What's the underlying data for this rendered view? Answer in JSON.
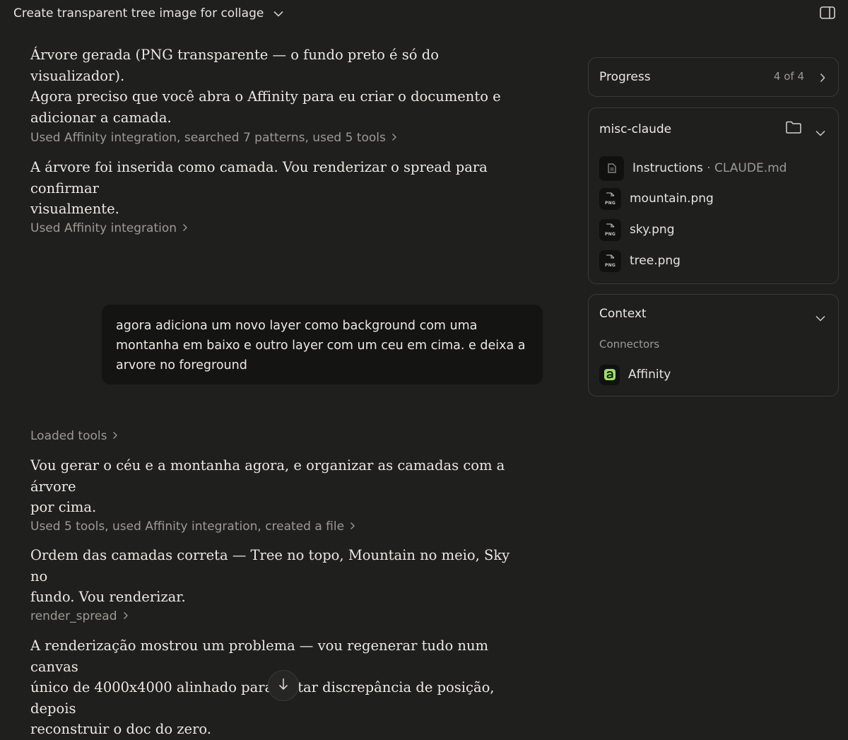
{
  "header": {
    "title": "Create transparent tree image for collage"
  },
  "chat": {
    "messages": [
      {
        "text_lines": [
          "Árvore gerada (PNG transparente — o fundo preto é só do visualizador).",
          "Agora preciso que você abra o Affinity para eu criar o documento e",
          "adicionar a camada."
        ]
      },
      {
        "tool": "Used Affinity integration, searched 7 patterns, used 5 tools"
      },
      {
        "text_lines": [
          "A árvore foi inserida como camada. Vou renderizar o spread para confirmar",
          "visualmente."
        ]
      },
      {
        "tool": "Used Affinity integration"
      },
      {
        "user_lines": [
          "agora adiciona um novo layer como background com uma",
          "montanha em baixo e outro layer com um ceu em cima. e deixa a",
          "arvore no foreground"
        ]
      },
      {
        "tool": "Loaded tools"
      },
      {
        "text_lines": [
          "Vou gerar o céu e a montanha agora, e organizar as camadas com a árvore",
          "por cima."
        ]
      },
      {
        "tool": "Used 5 tools, used Affinity integration, created a file"
      },
      {
        "text_lines": [
          "Ordem das camadas correta — Tree no topo, Mountain no meio, Sky no",
          "fundo. Vou renderizar."
        ]
      },
      {
        "tool": "render_spread"
      },
      {
        "text_lines": [
          "A renderização mostrou um problema — vou regenerar tudo num canvas",
          "único de 4000x4000 alinhado para evitar discrepância de posição, depois",
          "reconstruir o doc do zero."
        ]
      }
    ]
  },
  "sidebar": {
    "progress": {
      "title": "Progress",
      "count": "4 of 4"
    },
    "project": {
      "title": "misc-claude",
      "files": [
        {
          "name": "Instructions",
          "sub": " · CLAUDE.md",
          "icon": "document-icon"
        },
        {
          "name": "mountain.png",
          "sub": "",
          "icon": "png-file-icon"
        },
        {
          "name": "sky.png",
          "sub": "",
          "icon": "png-file-icon"
        },
        {
          "name": "tree.png",
          "sub": "",
          "icon": "png-file-icon"
        }
      ]
    },
    "context": {
      "title": "Context",
      "connectors_label": "Connectors",
      "connectors": [
        {
          "name": "Affinity",
          "icon": "affinity-icon"
        }
      ]
    }
  },
  "colors": {
    "background": "#1f1f1e",
    "user_bubble": "#141413",
    "muted_text": "#9d9a93",
    "affinity_green": "#9be15d"
  }
}
